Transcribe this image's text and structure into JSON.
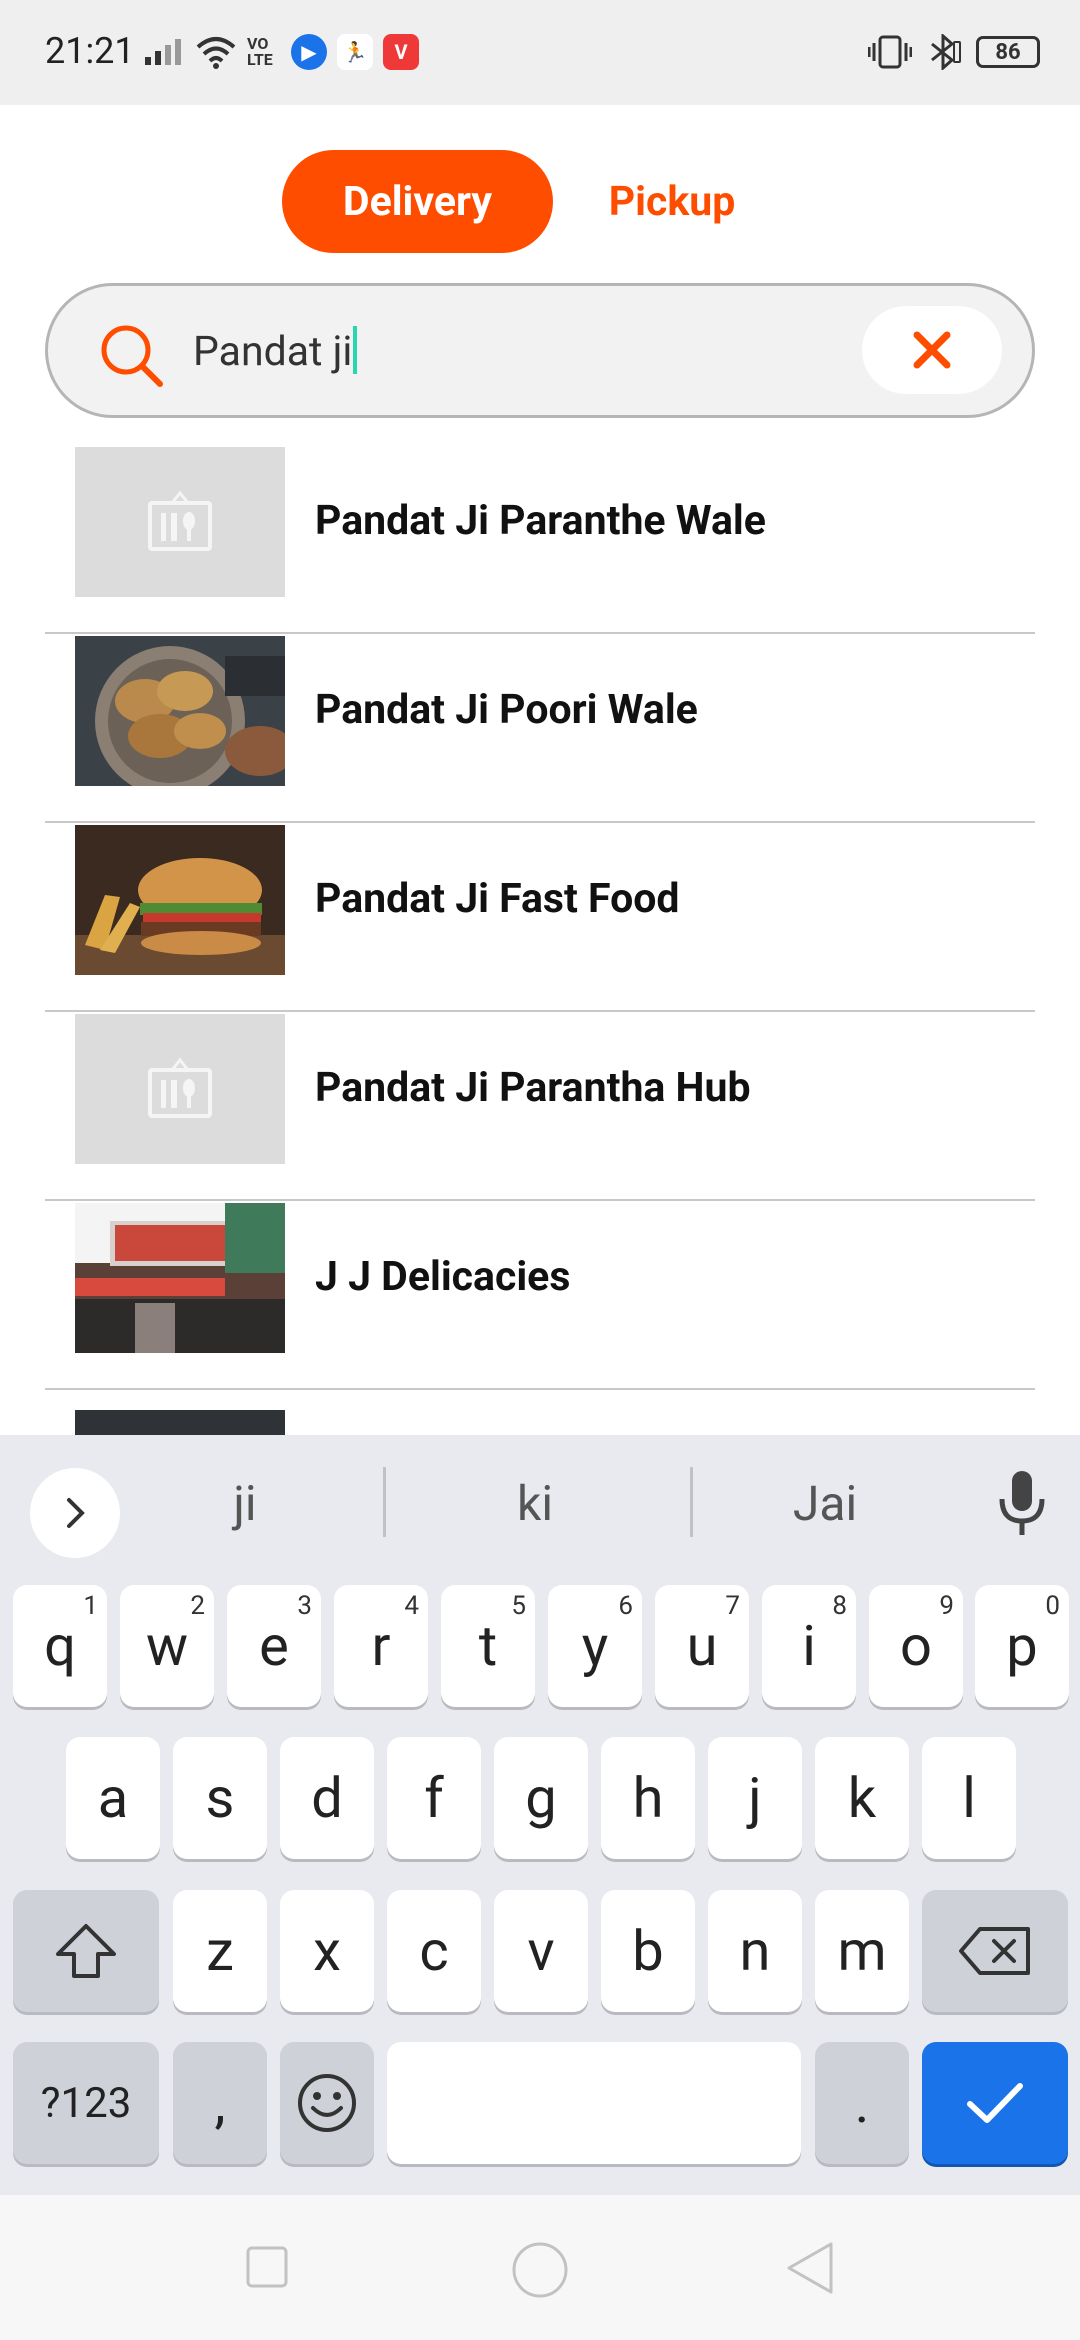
{
  "status_bar": {
    "time": "21:21",
    "battery": "86",
    "volte_label": "VO LTE"
  },
  "mode_toggle": {
    "delivery_label": "Delivery",
    "pickup_label": "Pickup",
    "active": "Delivery"
  },
  "search": {
    "value": "Pandat ji",
    "clear_icon": "close-icon"
  },
  "results": [
    {
      "name": "Pandat Ji Paranthe Wale",
      "thumb": "placeholder"
    },
    {
      "name": "Pandat Ji Poori Wale",
      "thumb": "poori-photo"
    },
    {
      "name": "Pandat Ji Fast Food",
      "thumb": "burger-photo"
    },
    {
      "name": "Pandat Ji Parantha Hub",
      "thumb": "placeholder"
    },
    {
      "name": "J J Delicacies",
      "thumb": "storefront-photo"
    }
  ],
  "keyboard": {
    "suggestions": [
      "ji",
      "ki",
      "Jai"
    ],
    "row1": [
      "q",
      "w",
      "e",
      "r",
      "t",
      "y",
      "u",
      "i",
      "o",
      "p"
    ],
    "row1_nums": [
      "1",
      "2",
      "3",
      "4",
      "5",
      "6",
      "7",
      "8",
      "9",
      "0"
    ],
    "row2": [
      "a",
      "s",
      "d",
      "f",
      "g",
      "h",
      "j",
      "k",
      "l"
    ],
    "row3": [
      "z",
      "x",
      "c",
      "v",
      "b",
      "n",
      "m"
    ],
    "symbols_label": "?123",
    "comma_label": ",",
    "period_label": "."
  },
  "colors": {
    "accent": "#ff4d00",
    "enter_key": "#1a73e8"
  }
}
